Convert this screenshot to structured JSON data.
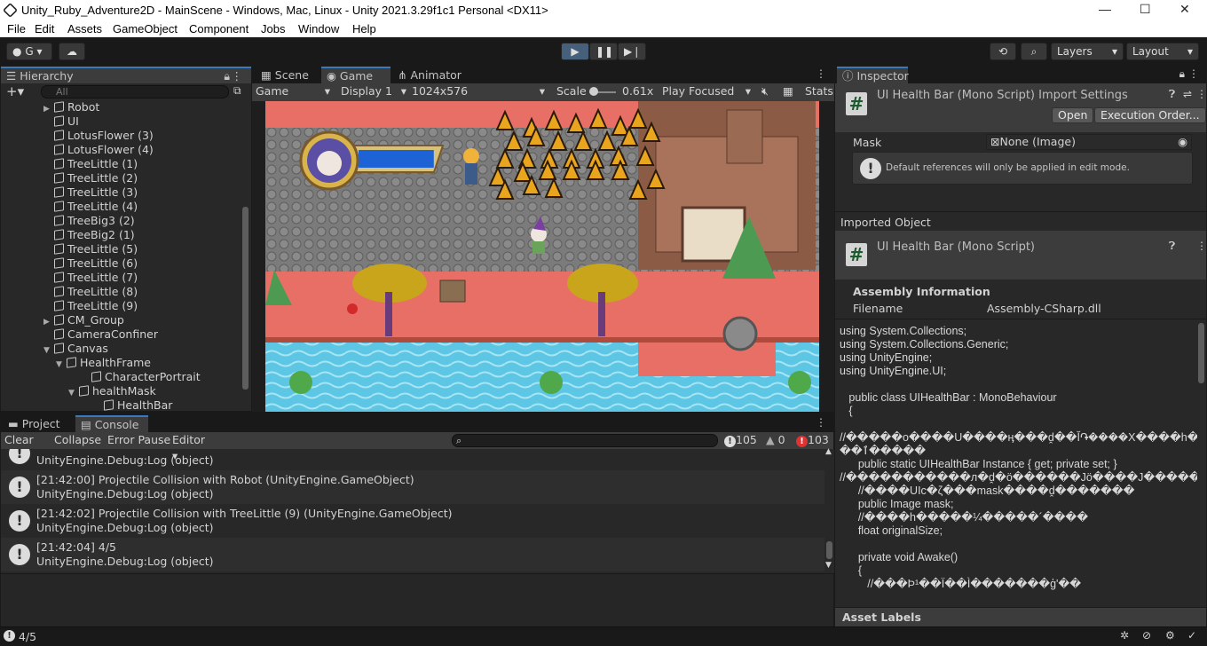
{
  "window": {
    "title": "Unity_Ruby_Adventure2D - MainScene - Windows, Mac, Linux - Unity 2021.3.29f1c1 Personal <DX11>",
    "controls": {
      "minimize": "—",
      "maximize": "☐",
      "close": "✕"
    }
  },
  "menu": [
    "File",
    "Edit",
    "Assets",
    "GameObject",
    "Component",
    "Jobs",
    "Window",
    "Help"
  ],
  "toolbar": {
    "account_label": "G",
    "layers_label": "Layers",
    "layout_label": "Layout",
    "play_color": "#46607c"
  },
  "hierarchy": {
    "tab_label": "Hierarchy",
    "search_placeholder": "All",
    "items": [
      {
        "label": "Robot",
        "expandable": true
      },
      {
        "label": "UI",
        "expandable": false
      },
      {
        "label": "LotusFlower (3)",
        "expandable": false
      },
      {
        "label": "LotusFlower (4)",
        "expandable": false
      },
      {
        "label": "TreeLittle (1)",
        "expandable": false
      },
      {
        "label": "TreeLittle (2)",
        "expandable": false
      },
      {
        "label": "TreeLittle (3)",
        "expandable": false
      },
      {
        "label": "TreeLittle (4)",
        "expandable": false
      },
      {
        "label": "TreeBig3 (2)",
        "expandable": false
      },
      {
        "label": "TreeBig2 (1)",
        "expandable": false
      },
      {
        "label": "TreeLittle (5)",
        "expandable": false
      },
      {
        "label": "TreeLittle (6)",
        "expandable": false
      },
      {
        "label": "TreeLittle (7)",
        "expandable": false
      },
      {
        "label": "TreeLittle (8)",
        "expandable": false
      },
      {
        "label": "TreeLittle (9)",
        "expandable": false
      },
      {
        "label": "CM_Group",
        "expandable": true
      },
      {
        "label": "CameraConfiner",
        "expandable": false
      },
      {
        "label": "Canvas",
        "expandable": true,
        "expanded": true
      },
      {
        "label": "HealthFrame",
        "expandable": true,
        "expanded": true
      },
      {
        "label": "CharacterPortrait",
        "expandable": false
      },
      {
        "label": "healthMask",
        "expandable": true,
        "expanded": true
      },
      {
        "label": "HealthBar",
        "expandable": false
      }
    ]
  },
  "viewtabs": {
    "scene": "Scene",
    "game": "Game",
    "animator": "Animator"
  },
  "gamebar": {
    "mode": "Game",
    "display": "Display 1",
    "resolution": "1024x576",
    "scale_label": "Scale",
    "scale_value": "0.61x",
    "play_focused": "Play Focused",
    "stats": "Stats"
  },
  "game": {
    "health_fraction": 0.8,
    "health_color": "#1e63d6",
    "ground_color": "#e86f66",
    "water_color": "#5cc6e4"
  },
  "bottomtabs": {
    "project": "Project",
    "console": "Console"
  },
  "console": {
    "clear": "Clear",
    "collapse": "Collapse",
    "error_pause": "Error Pause",
    "editor": "Editor",
    "counts": {
      "log": "105",
      "warn": "0",
      "error": "103"
    },
    "entries": [
      {
        "line1": "",
        "line2": "UnityEngine.Debug:Log (object)"
      },
      {
        "line1": "[21:42:00] Projectile Collision with Robot (UnityEngine.GameObject)",
        "line2": "UnityEngine.Debug:Log (object)"
      },
      {
        "line1": "[21:42:02] Projectile Collision with TreeLittle (9) (UnityEngine.GameObject)",
        "line2": "UnityEngine.Debug:Log (object)"
      },
      {
        "line1": "[21:42:04] 4/5",
        "line2": "UnityEngine.Debug:Log (object)"
      }
    ]
  },
  "inspector": {
    "tab_label": "Inspector",
    "header_title": "UI Health Bar (Mono Script) Import Settings",
    "open_button": "Open",
    "exec_order_button": "Execution Order...",
    "mask_label": "Mask",
    "mask_value": "None (Image)",
    "help_text": "Default references will only be applied in edit mode.",
    "imported_object": "Imported Object",
    "script_title": "UI Health Bar (Mono Script)",
    "assembly_info": "Assembly Information",
    "filename_label": "Filename",
    "filename_value": "Assembly-CSharp.dll",
    "code_lines": [
      "using System.Collections;",
      "using System.Collections.Generic;",
      "using UnityEngine;",
      "using UnityEngine.UI;",
      "",
      "   public class UIHealthBar : MonoBehaviour",
      "   {",
      "",
      "//�����o����U����ӊ���ḓ��Ĭ֏����X����h����Ӂ",
      "��ٱ�����",
      "      public static UIHealthBar Instance { get; private set; }",
      "//�����������л�ḓ�ö������Jö����J�����и.",
      "      //����UIc�ζ���mask����ḓ�������",
      "      public Image mask;",
      "      //����h�����¼�����´����",
      "      float originalSize;",
      "",
      "      private void Awake()",
      "      {",
      "         //���Þ¹��Ï��Ì�������ģ'��"
    ],
    "asset_labels": "Asset Labels"
  },
  "status": {
    "message": "4/5"
  }
}
